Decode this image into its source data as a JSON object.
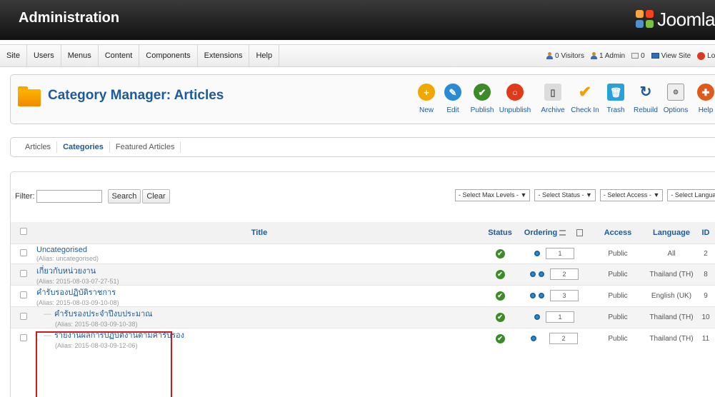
{
  "header": {
    "title": "Administration",
    "logo_text": "Joomla"
  },
  "menu": {
    "items": [
      "Site",
      "Users",
      "Menus",
      "Content",
      "Components",
      "Extensions",
      "Help"
    ],
    "status": {
      "visitors": "0 Visitors",
      "admins": "1 Admin",
      "messages": "0",
      "view_site": "View Site",
      "logout": "Log o"
    }
  },
  "toolbar": {
    "heading": "Category Manager: Articles",
    "buttons": [
      {
        "label": "New",
        "icon": "plus-icon",
        "color": "#f0a800"
      },
      {
        "label": "Edit",
        "icon": "pencil-icon",
        "color": "#2a8ad6"
      },
      {
        "label": "Publish",
        "icon": "check-icon",
        "color": "#3d8b28"
      },
      {
        "label": "Unpublish",
        "icon": "circle-icon",
        "color": "#e03a1a"
      },
      {
        "label": "Archive",
        "icon": "archive-icon",
        "color": "#777777"
      },
      {
        "label": "Check In",
        "icon": "checkmark-icon",
        "color": "#f0a000"
      },
      {
        "label": "Trash",
        "icon": "trash-icon",
        "color": "#2aa0d8"
      },
      {
        "label": "Rebuild",
        "icon": "refresh-icon",
        "color": "#1d5a9c"
      },
      {
        "label": "Options",
        "icon": "options-icon",
        "color": "#666666"
      },
      {
        "label": "Help",
        "icon": "lifebuoy-icon",
        "color": "#e05a1a"
      }
    ]
  },
  "submenu": {
    "items": [
      "Articles",
      "Categories",
      "Featured Articles"
    ],
    "active": "Categories"
  },
  "filter": {
    "label": "Filter:",
    "value": "",
    "search_label": "Search",
    "clear_label": "Clear",
    "selects": [
      "- Select Max Levels -",
      "- Select Status -",
      "- Select Access -",
      "- Select Language -"
    ]
  },
  "table": {
    "headers": {
      "title": "Title",
      "status": "Status",
      "ordering": "Ordering",
      "access": "Access",
      "language": "Language",
      "id": "ID"
    },
    "rows": [
      {
        "title": "Uncategorised",
        "alias": "(Alias: uncategorised)",
        "ordering": "1",
        "access": "Public",
        "language": "All",
        "id": "2",
        "child": false,
        "arrows": 1
      },
      {
        "title": "เกี่ยวกับหน่วยงาน",
        "alias": "(Alias: 2015-08-03-07-27-51)",
        "ordering": "2",
        "access": "Public",
        "language": "Thailand (TH)",
        "id": "8",
        "child": false,
        "arrows": 2
      },
      {
        "title": "คำรับรองปฏิบัติราชการ",
        "alias": "(Alias: 2015-08-03-09-10-08)",
        "ordering": "3",
        "access": "Public",
        "language": "English (UK)",
        "id": "9",
        "child": false,
        "arrows": 2
      },
      {
        "title": "คำรับรองประจำปีงบประมาณ",
        "alias": "(Alias: 2015-08-03-09-10-38)",
        "ordering": "1",
        "access": "Public",
        "language": "Thailand (TH)",
        "id": "10",
        "child": true,
        "arrows": 1
      },
      {
        "title": "รายงานผลการปฏิบัติงานตามคำรับรอง",
        "alias": "(Alias: 2015-08-03-09-12-06)",
        "ordering": "2",
        "access": "Public",
        "language": "Thailand (TH)",
        "id": "11",
        "child": true,
        "arrows": 1
      }
    ]
  }
}
